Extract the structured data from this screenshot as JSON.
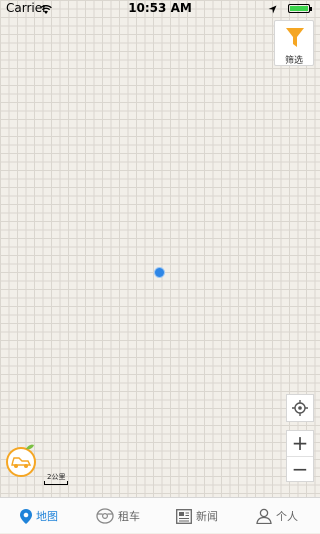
{
  "status_bar": {
    "carrier": "Carrier",
    "time": "10:53 AM",
    "battery_level": 1.0
  },
  "filter_button": {
    "label": "筛选"
  },
  "map": {
    "scale_label": "2公里"
  },
  "zoom": {
    "in": "+",
    "out": "−"
  },
  "tabs": [
    {
      "label": "地图",
      "icon": "map-pin-icon",
      "active": true
    },
    {
      "label": "租车",
      "icon": "steering-wheel-icon",
      "active": false
    },
    {
      "label": "新闻",
      "icon": "news-icon",
      "active": false
    },
    {
      "label": "个人",
      "icon": "person-icon",
      "active": false
    }
  ],
  "colors": {
    "accent": "#1f83d9",
    "filter_icon": "#f5a623",
    "logo": "#f5a623",
    "location_dot": "#2e86e6"
  }
}
